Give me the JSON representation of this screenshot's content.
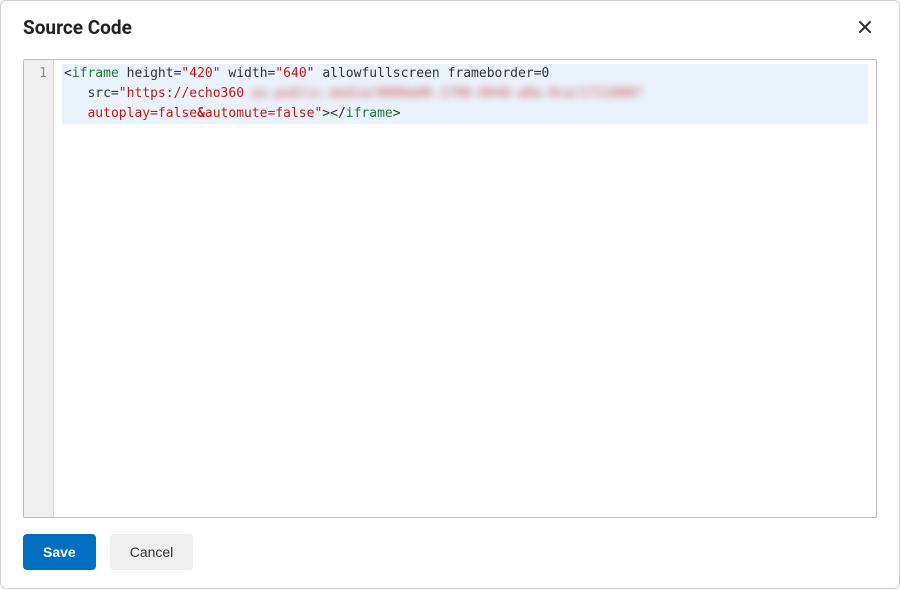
{
  "dialog": {
    "title": "Source Code",
    "close_label": "Close"
  },
  "editor": {
    "line_numbers": [
      "1"
    ],
    "code": {
      "line1": {
        "open_bracket": "<",
        "tag": "iframe",
        "sp1": " ",
        "attr_height": "height",
        "eq1": "=",
        "val_height": "\"420\"",
        "sp2": " ",
        "attr_width": "width",
        "eq2": "=",
        "val_width": "\"640\"",
        "sp3": " ",
        "attr_afs": "allowfullscreen",
        "sp4": " ",
        "attr_fb": "frameborder",
        "eq3": "=",
        "val_fb": "0"
      },
      "line2": {
        "indent": "   ",
        "attr_src": "src",
        "eq": "=",
        "q_open": "\"",
        "url_vis": "https://echo360",
        "url_hidden": ".au.public.media/0000a00-1700-0040-a0a-0ca/1711000?"
      },
      "line3": {
        "indent": "   ",
        "qs1": "autoplay=false",
        "amp": "&",
        "qs2": "automute=false",
        "q_close": "\"",
        "gt": ">",
        "lt_close": "</",
        "tag": "iframe",
        "gt2": ">"
      }
    }
  },
  "buttons": {
    "save": "Save",
    "cancel": "Cancel"
  }
}
